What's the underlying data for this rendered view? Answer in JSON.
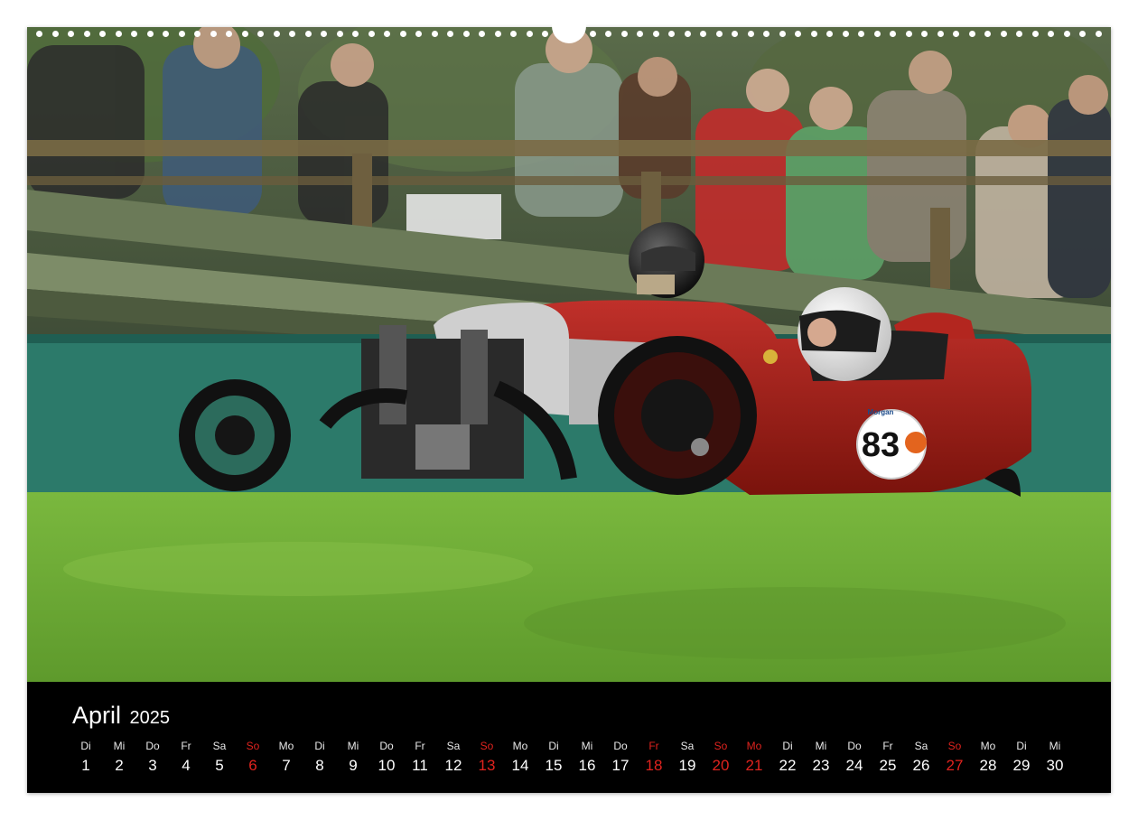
{
  "calendar": {
    "month": "April",
    "year": "2025",
    "days": [
      {
        "name": "Di",
        "num": "1",
        "red": false
      },
      {
        "name": "Mi",
        "num": "2",
        "red": false
      },
      {
        "name": "Do",
        "num": "3",
        "red": false
      },
      {
        "name": "Fr",
        "num": "4",
        "red": false
      },
      {
        "name": "Sa",
        "num": "5",
        "red": false
      },
      {
        "name": "So",
        "num": "6",
        "red": true
      },
      {
        "name": "Mo",
        "num": "7",
        "red": false
      },
      {
        "name": "Di",
        "num": "8",
        "red": false
      },
      {
        "name": "Mi",
        "num": "9",
        "red": false
      },
      {
        "name": "Do",
        "num": "10",
        "red": false
      },
      {
        "name": "Fr",
        "num": "11",
        "red": false
      },
      {
        "name": "Sa",
        "num": "12",
        "red": false
      },
      {
        "name": "So",
        "num": "13",
        "red": true
      },
      {
        "name": "Mo",
        "num": "14",
        "red": false
      },
      {
        "name": "Di",
        "num": "15",
        "red": false
      },
      {
        "name": "Mi",
        "num": "16",
        "red": false
      },
      {
        "name": "Do",
        "num": "17",
        "red": false
      },
      {
        "name": "Fr",
        "num": "18",
        "red": true
      },
      {
        "name": "Sa",
        "num": "19",
        "red": false
      },
      {
        "name": "So",
        "num": "20",
        "red": true
      },
      {
        "name": "Mo",
        "num": "21",
        "red": true
      },
      {
        "name": "Di",
        "num": "22",
        "red": false
      },
      {
        "name": "Mi",
        "num": "23",
        "red": false
      },
      {
        "name": "Do",
        "num": "24",
        "red": false
      },
      {
        "name": "Fr",
        "num": "25",
        "red": false
      },
      {
        "name": "Sa",
        "num": "26",
        "red": false
      },
      {
        "name": "So",
        "num": "27",
        "red": true
      },
      {
        "name": "Mo",
        "num": "28",
        "red": false
      },
      {
        "name": "Di",
        "num": "29",
        "red": false
      },
      {
        "name": "Mi",
        "num": "30",
        "red": false
      }
    ]
  },
  "photo": {
    "race_number": "83",
    "badge_text": "Morgan",
    "colors": {
      "grass": "#6aa832",
      "car_body": "#9b1c14",
      "barrier": "#2c7a6a",
      "holiday_red": "#e0231e"
    }
  }
}
